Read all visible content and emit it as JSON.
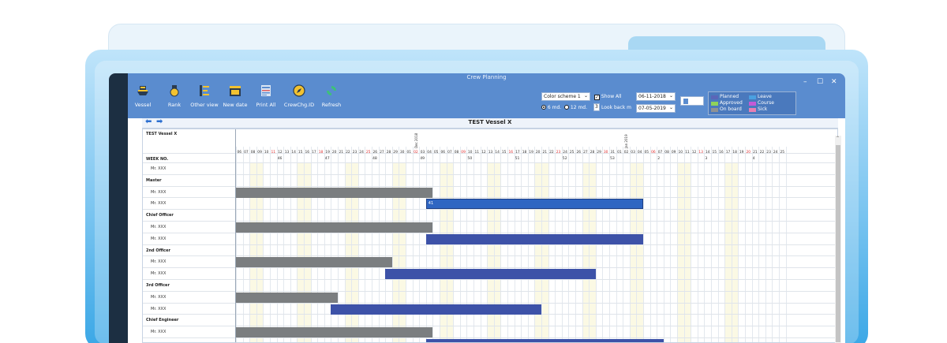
{
  "window": {
    "title": "Crew Planning",
    "controls": [
      "–",
      "☐",
      "✕"
    ]
  },
  "toolbar": {
    "buttons": [
      {
        "label": "Vessel",
        "icon": "ship-icon"
      },
      {
        "label": "Rank",
        "icon": "medal-icon"
      },
      {
        "label": "Other view",
        "icon": "list-view-icon"
      },
      {
        "label": "New date",
        "icon": "calendar-icon"
      },
      {
        "label": "Print All",
        "icon": "print-icon"
      },
      {
        "label": "CrewChg.ID",
        "icon": "compass-icon"
      },
      {
        "label": "Refresh",
        "icon": "refresh-icon"
      }
    ]
  },
  "controls": {
    "color_scheme": "Color scheme 1",
    "show_all_label": "Show All",
    "show_all_checked": true,
    "period_6md": "6 md.",
    "period_12md": "12 md.",
    "period_selected": "6 md.",
    "look_back_value": "3",
    "look_back_label": "Look back m",
    "date_from": "06-11-2018",
    "date_to": "07-05-2019"
  },
  "legend": [
    {
      "label": "Planned",
      "color": "#5a66b8"
    },
    {
      "label": "Leave",
      "color": "#4aa0e0"
    },
    {
      "label": "Approved",
      "color": "#8fd35a"
    },
    {
      "label": "Course",
      "color": "#c35ad6"
    },
    {
      "label": "On board",
      "color": "#8f9294"
    },
    {
      "label": "Sick",
      "color": "#e87fb3"
    }
  ],
  "grid": {
    "title": "TEST Vessel X",
    "vessel_label": "TEST Vessel X",
    "month_labels": [
      {
        "text": "Dec 2018",
        "col": 26
      },
      {
        "text": "Jan 2019",
        "col": 57
      }
    ],
    "days": [
      "06",
      "07",
      "08",
      "09",
      "10",
      "11",
      "12",
      "13",
      "14",
      "15",
      "16",
      "17",
      "18",
      "19",
      "20",
      "21",
      "22",
      "23",
      "24",
      "25",
      "26",
      "27",
      "28",
      "29",
      "30",
      "01",
      "02",
      "03",
      "04",
      "05",
      "06",
      "07",
      "08",
      "09",
      "10",
      "11",
      "12",
      "13",
      "14",
      "15",
      "16",
      "17",
      "18",
      "19",
      "20",
      "21",
      "22",
      "23",
      "24",
      "25",
      "26",
      "27",
      "28",
      "29",
      "30",
      "31",
      "01",
      "02",
      "03",
      "04",
      "05",
      "06",
      "07",
      "08",
      "09",
      "10",
      "11",
      "12",
      "13",
      "14",
      "15",
      "16",
      "17",
      "18",
      "19",
      "20",
      "21",
      "22",
      "23",
      "24",
      "25"
    ],
    "red_cols": [
      5,
      12,
      19,
      26,
      33,
      40,
      47,
      54,
      61,
      68,
      75
    ],
    "weekend_cols": [
      2,
      9,
      16,
      23,
      30,
      37,
      44,
      51,
      58,
      65,
      72
    ],
    "week_label": "WEEK NO.",
    "weeks": [
      {
        "text": "46",
        "col": 6
      },
      {
        "text": "47",
        "col": 13
      },
      {
        "text": "48",
        "col": 20
      },
      {
        "text": "49",
        "col": 27
      },
      {
        "text": "50",
        "col": 34
      },
      {
        "text": "51",
        "col": 41
      },
      {
        "text": "52",
        "col": 48
      },
      {
        "text": "53",
        "col": 55
      },
      {
        "text": "2",
        "col": 62
      },
      {
        "text": "3",
        "col": 69
      },
      {
        "text": "4",
        "col": 76
      }
    ],
    "rows": [
      {
        "type": "crew",
        "label": "Mr. XXX"
      },
      {
        "type": "rank",
        "label": "Master"
      },
      {
        "type": "crew",
        "label": "Mr. XXX",
        "bar": {
          "style": "gray",
          "start": 0,
          "end": 29
        }
      },
      {
        "type": "crew",
        "label": "Mr. XXX",
        "bar": {
          "style": "bright",
          "start": 28,
          "end": 60,
          "text": "41"
        }
      },
      {
        "type": "rank",
        "label": "Chief Officer"
      },
      {
        "type": "crew",
        "label": "Mr. XXX",
        "bar": {
          "style": "gray",
          "start": 0,
          "end": 29
        }
      },
      {
        "type": "crew",
        "label": "Mr. XXX",
        "bar": {
          "style": "blue",
          "start": 28,
          "end": 60
        }
      },
      {
        "type": "rank",
        "label": "2nd Officer"
      },
      {
        "type": "crew",
        "label": "Mr. XXX",
        "bar": {
          "style": "gray",
          "start": 0,
          "end": 23
        }
      },
      {
        "type": "crew",
        "label": "Mr. XXX",
        "bar": {
          "style": "blue",
          "start": 22,
          "end": 53
        }
      },
      {
        "type": "rank",
        "label": "3rd Officer"
      },
      {
        "type": "crew",
        "label": "Mr. XXX",
        "bar": {
          "style": "gray",
          "start": 0,
          "end": 15
        }
      },
      {
        "type": "crew",
        "label": "Mr. XXX",
        "bar": {
          "style": "blue",
          "start": 14,
          "end": 45
        }
      },
      {
        "type": "rank",
        "label": "Chief Engineer"
      },
      {
        "type": "crew",
        "label": "Mr. XXX",
        "bar": {
          "style": "gray",
          "start": 0,
          "end": 29
        }
      },
      {
        "type": "crew",
        "label": "",
        "bar": {
          "style": "blue",
          "start": 28,
          "end": 63
        }
      }
    ]
  }
}
